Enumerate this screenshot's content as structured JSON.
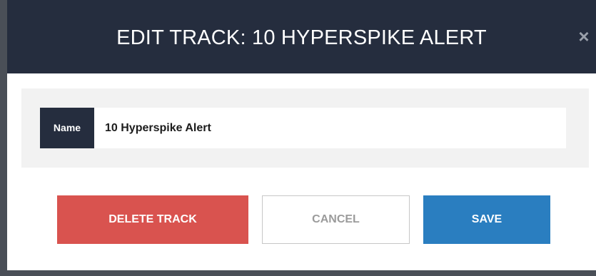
{
  "dialog": {
    "title": "EDIT TRACK: 10 HYPERSPIKE ALERT",
    "close_label": "×"
  },
  "form": {
    "name_label": "Name",
    "name_value": "10 Hyperspike Alert"
  },
  "actions": {
    "delete_label": "DELETE TRACK",
    "cancel_label": "CANCEL",
    "save_label": "SAVE"
  },
  "colors": {
    "header": "#252d3e",
    "delete": "#d9534f",
    "save": "#2a7ec0",
    "body_panel": "#f2f2f2"
  }
}
